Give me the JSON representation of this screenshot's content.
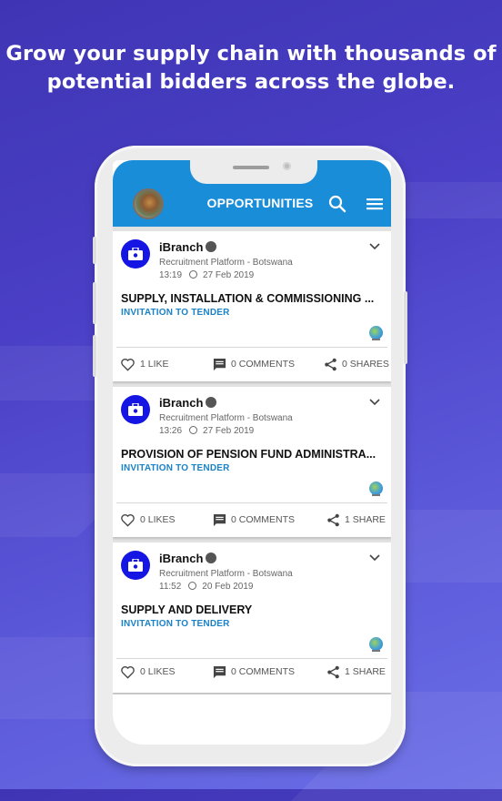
{
  "headline": {
    "line1": "Grow your supply chain with thousands of",
    "line2": "potential bidders across the globe."
  },
  "app": {
    "title": "OPPORTUNITIES",
    "accent_color": "#1a8dd8",
    "icons": {
      "left": "user-avatar",
      "search": "search-icon",
      "menu": "hamburger-menu-icon"
    }
  },
  "posts": [
    {
      "author": "iBranch",
      "verified": true,
      "organization": "Recruitment Platform - Botswana",
      "time": "13:19",
      "date": "27 Feb 2019",
      "title": "SUPPLY, INSTALLATION & COMMISSIONING ...",
      "tag": "INVITATION TO TENDER",
      "likes": "1 LIKE",
      "comments": "0 COMMENTS",
      "shares": "0 SHARES"
    },
    {
      "author": "iBranch",
      "verified": true,
      "organization": "Recruitment Platform - Botswana",
      "time": "13:26",
      "date": "27 Feb 2019",
      "title": "PROVISION OF PENSION FUND ADMINISTRA...",
      "tag": "INVITATION TO TENDER",
      "likes": "0 LIKES",
      "comments": "0 COMMENTS",
      "shares": "1 SHARE"
    },
    {
      "author": "iBranch",
      "verified": true,
      "organization": "Recruitment Platform - Botswana",
      "time": "11:52",
      "date": "20 Feb 2019",
      "title": "SUPPLY AND DELIVERY",
      "tag": "INVITATION TO TENDER",
      "likes": "0 LIKES",
      "comments": "0 COMMENTS",
      "shares": "1 SHARE"
    }
  ]
}
